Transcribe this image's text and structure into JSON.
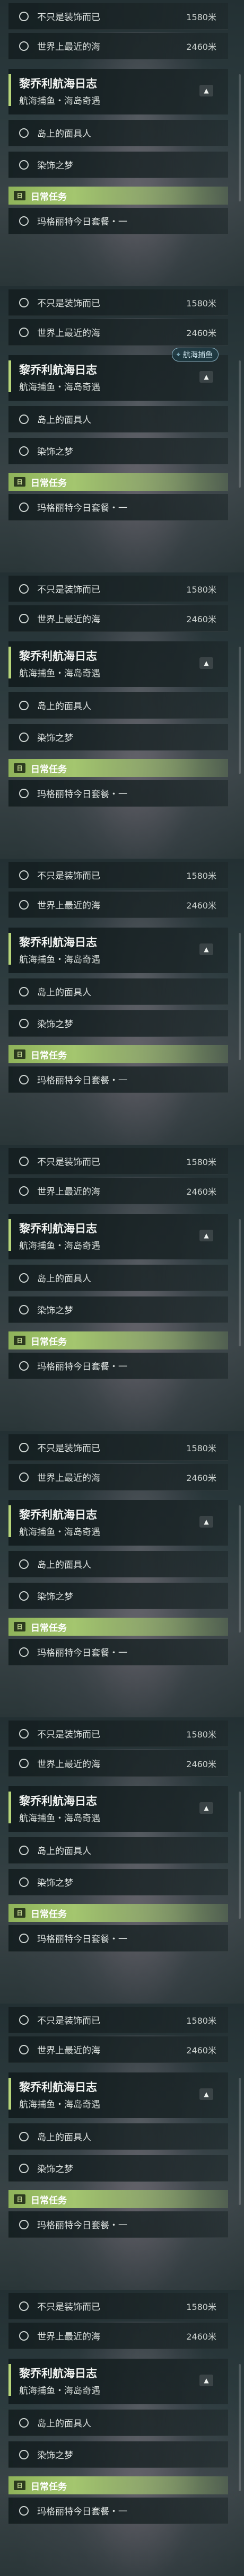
{
  "blocks": [
    {
      "top_rows": [
        {
          "label": "不只是装饰而已",
          "distance": "1580米"
        },
        {
          "label": "世界上最近的海",
          "distance": "2460米"
        }
      ],
      "quest": {
        "title": "黎乔利航海日志",
        "subtitle": "航海捕鱼・海岛奇遇"
      },
      "show_nav_tag": false,
      "sub_rows": [
        {
          "label": "岛上的面具人"
        },
        {
          "label": "染饰之梦"
        }
      ],
      "daily_label": "日常任务",
      "daily_item": "玛格丽特今日套餐・一"
    }
  ],
  "nav_tag_label": "航海捕鱼",
  "daily_icon_glyph": "日",
  "collapse_glyph": "▲",
  "pin_glyph": "⌖",
  "accent_color": "#b7d67a",
  "daily_color": "#9bbd64"
}
